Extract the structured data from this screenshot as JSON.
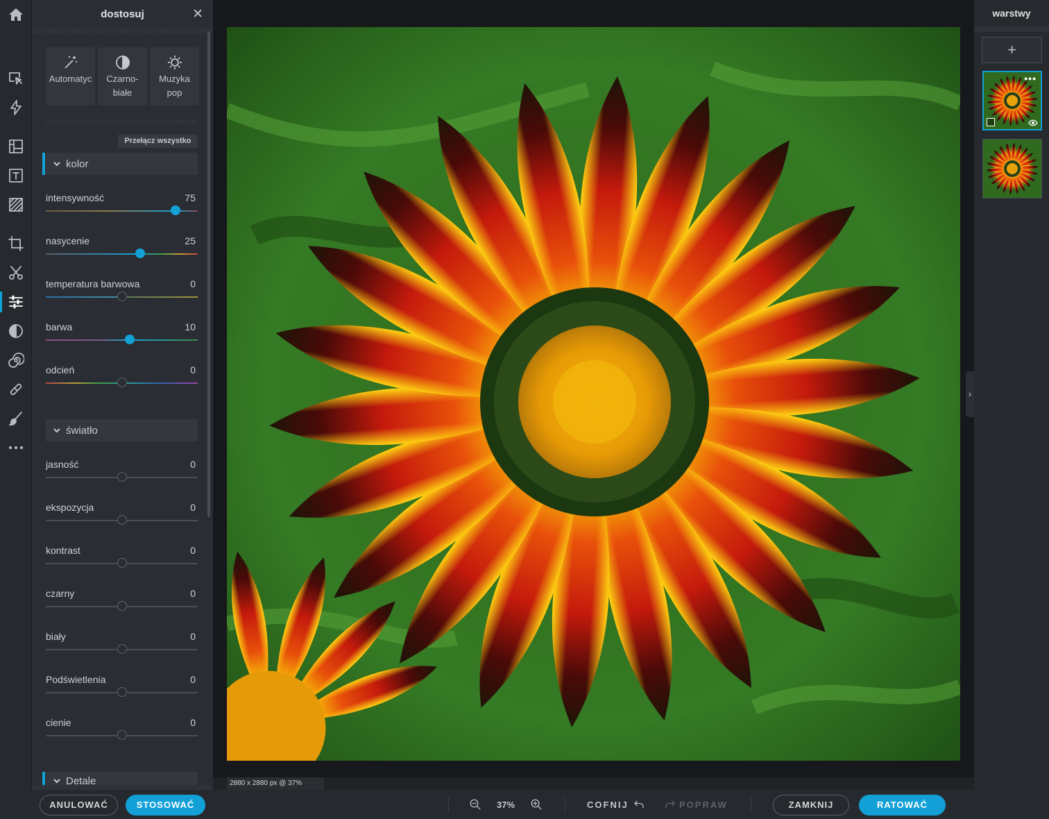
{
  "panel": {
    "title": "dostosuj",
    "presets": [
      {
        "label_line1": "Automatyc",
        "label_line2": "",
        "icon": "magic-wand-icon"
      },
      {
        "label_line1": "Czarno-",
        "label_line2": "białe",
        "icon": "contrast-circle-icon"
      },
      {
        "label_line1": "Muzyka",
        "label_line2": "pop",
        "icon": "sun-gear-icon"
      }
    ],
    "toggle_all_label": "Przełącz wszystko",
    "sections": {
      "color": "kolor",
      "light": "światło",
      "details": "Detale"
    },
    "color_sliders": [
      {
        "label": "intensywność",
        "value": "75"
      },
      {
        "label": "nasycenie",
        "value": "25"
      },
      {
        "label": "temperatura barwowa",
        "value": "0"
      },
      {
        "label": "barwa",
        "value": "10"
      },
      {
        "label": "odcień",
        "value": "0"
      }
    ],
    "light_sliders": [
      {
        "label": "jasność",
        "value": "0"
      },
      {
        "label": "ekspozycja",
        "value": "0"
      },
      {
        "label": "kontrast",
        "value": "0"
      },
      {
        "label": "czarny",
        "value": "0"
      },
      {
        "label": "biały",
        "value": "0"
      },
      {
        "label": "Podświetlenia",
        "value": "0"
      },
      {
        "label": "cienie",
        "value": "0"
      }
    ],
    "cancel_label": "ANULOWAĆ",
    "apply_label": "STOSOWAĆ"
  },
  "canvas": {
    "size_info": "2880 x 2880 px @ 37%"
  },
  "toolbar": {
    "zoom_value": "37%",
    "undo_label": "COFNIJ",
    "redo_label": "POPRAW",
    "close_label": "ZAMKNIJ",
    "save_label": "RATOWAĆ"
  },
  "layers": {
    "title": "warstwy",
    "add_label": "+"
  },
  "colors": {
    "accent": "#12a0d7",
    "panel_bg": "#2a2d33",
    "canvas_bg": "#17181b"
  }
}
